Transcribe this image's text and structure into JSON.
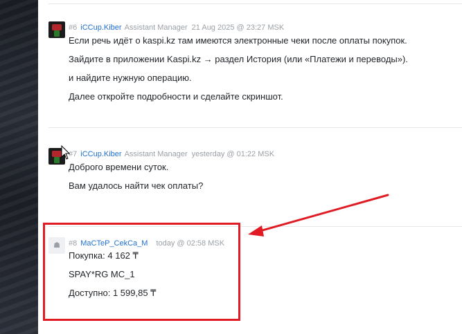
{
  "posts": [
    {
      "number": "#6",
      "username": "iCCup.Kiber",
      "role": "Assistant Manager",
      "timestamp": "21 Aug 2025 @ 23:27 MSK",
      "lines": [
        "Если речь идёт о kaspi.kz там имеются электронные чеки после оплаты покупок.",
        "Зайдите в приложении Kaspi.kz → раздел История (или «Платежи и переводы»).",
        "и найдите нужную операцию.",
        "Далее откройте подробности и сделайте скриншот."
      ]
    },
    {
      "number": "#7",
      "username": "iCCup.Kiber",
      "role": "Assistant Manager",
      "timestamp": "yesterday @ 01:22 MSK",
      "lines": [
        "Доброго времени суток.",
        "Вам удалось найти чек оплаты?"
      ]
    },
    {
      "number": "#8",
      "username": "MaCTeP_CekCa_M",
      "role": "",
      "timestamp": "today @ 02:58 MSK",
      "lines": [
        "Покупка: 4 162 ₸",
        "SPAY*RG MC_1",
        "Доступно: 1 599,85 ₸"
      ]
    }
  ],
  "colors": {
    "username": "#1f6fd1",
    "meta": "#9aa0a6",
    "highlight": "#e01b24"
  },
  "icons": {
    "avatar_user": "user-silhouette-icon",
    "cursor": "mouse-pointer-icon",
    "annotation": "red-arrow-icon"
  }
}
